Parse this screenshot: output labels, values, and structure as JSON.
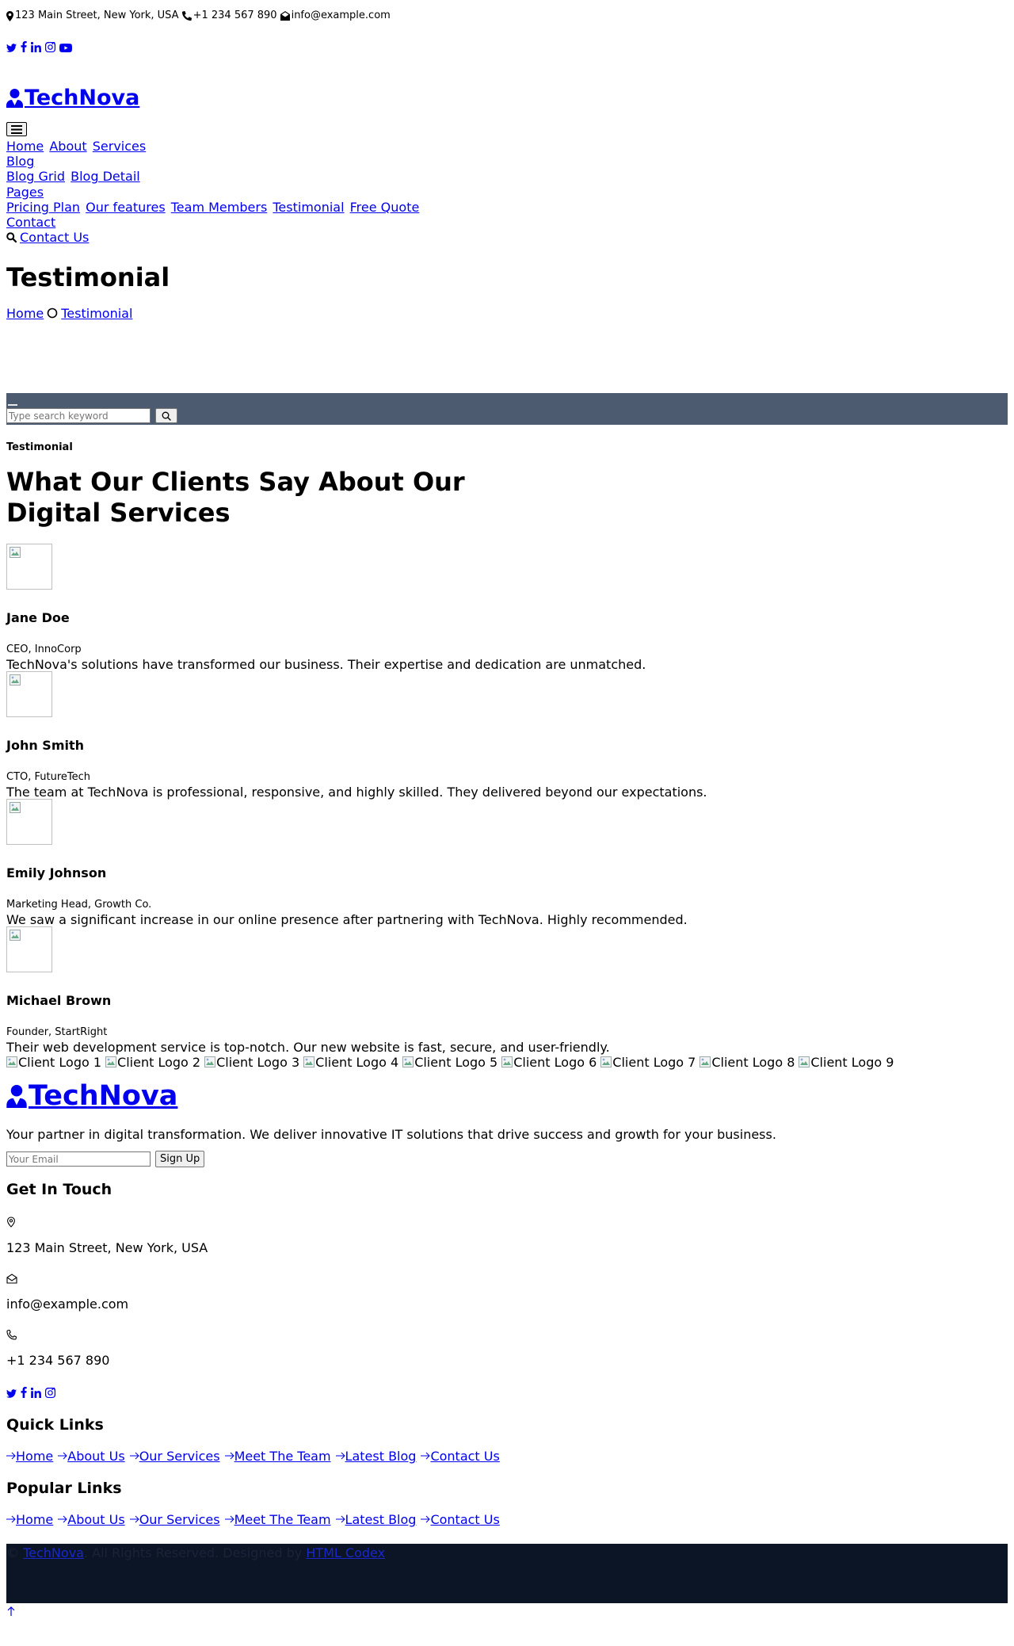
{
  "topbar": {
    "address": "123 Main Street, New York, USA",
    "phone": "+1 234 567 890",
    "email": "info@example.com",
    "social": [
      "twitter-icon",
      "facebook-icon",
      "linkedin-icon",
      "instagram-icon",
      "youtube-icon"
    ]
  },
  "brand": {
    "name": "TechNova"
  },
  "nav": {
    "toggle_icon": "menu-icon",
    "rows": [
      [
        "Home",
        "About",
        "Services"
      ],
      [
        "Blog"
      ],
      [
        "Blog Grid",
        "Blog Detail"
      ],
      [
        "Pages"
      ],
      [
        "Pricing Plan",
        "Our features",
        "Team Members",
        "Testimonial",
        "Free Quote"
      ],
      [
        "Contact"
      ]
    ],
    "contact_us": "Contact Us"
  },
  "page_header": {
    "title": "Testimonial",
    "breadcrumb": [
      "Home",
      "Testimonial"
    ]
  },
  "search": {
    "placeholder": "Type search keyword"
  },
  "testimonials": {
    "tag": "Testimonial",
    "title": "What Our Clients Say About Our Digital Services",
    "items": [
      {
        "name": "Jane Doe",
        "role": "CEO, InnoCorp",
        "quote": "TechNova's solutions have transformed our business. Their expertise and dedication are unmatched."
      },
      {
        "name": "John Smith",
        "role": "CTO, FutureTech",
        "quote": "The team at TechNova is professional, responsive, and highly skilled. They delivered beyond our expectations."
      },
      {
        "name": "Emily Johnson",
        "role": "Marketing Head, Growth Co.",
        "quote": "We saw a significant increase in our online presence after partnering with TechNova. Highly recommended."
      },
      {
        "name": "Michael Brown",
        "role": "Founder, StartRight",
        "quote": "Their web development service is top-notch. Our new website is fast, secure, and user-friendly."
      }
    ]
  },
  "clients": [
    "Client Logo 1",
    "Client Logo 2",
    "Client Logo 3",
    "Client Logo 4",
    "Client Logo 5",
    "Client Logo 6",
    "Client Logo 7",
    "Client Logo 8",
    "Client Logo 9"
  ],
  "footer": {
    "about": "Your partner in digital transformation. We deliver innovative IT solutions that drive success and growth for your business.",
    "newsletter": {
      "placeholder": "Your Email",
      "button": "Sign Up"
    },
    "contact_heading": "Get In Touch",
    "address": "123 Main Street, New York, USA",
    "email": "info@example.com",
    "phone": "+1 234 567 890",
    "social": [
      "twitter-icon",
      "facebook-icon",
      "linkedin-icon",
      "instagram-icon"
    ],
    "quick_links_heading": "Quick Links",
    "quick_links": [
      "Home",
      "About Us",
      "Our Services",
      "Meet The Team",
      "Latest Blog",
      "Contact Us"
    ],
    "popular_links_heading": "Popular Links",
    "popular_links": [
      "Home",
      "About Us",
      "Our Services",
      "Meet The Team",
      "Latest Blog",
      "Contact Us"
    ],
    "copyright": {
      "prefix": "©",
      "brand": "TechNova",
      "middle": ". All Rights Reserved. Designed by",
      "designer": "HTML Codex"
    },
    "back_to_top_icon": "arrow-up-icon"
  },
  "colors": {
    "link": "#0000ee",
    "search_band": "#4d5b71",
    "copyright_bg": "#0b1526"
  }
}
